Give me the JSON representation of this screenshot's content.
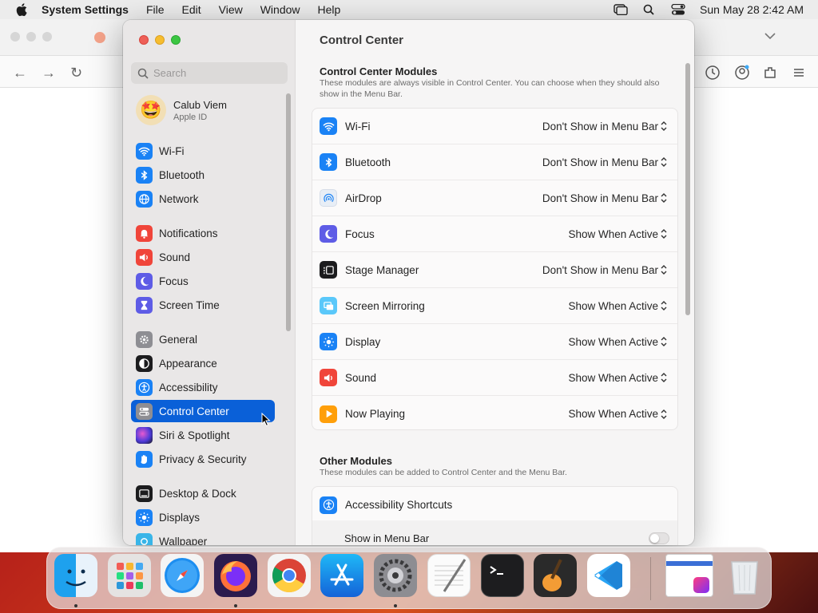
{
  "menubar": {
    "app_name": "System Settings",
    "menus": [
      "File",
      "Edit",
      "View",
      "Window",
      "Help"
    ],
    "datetime": "Sun May 28  2:42 AM"
  },
  "sidebar": {
    "search_placeholder": "Search",
    "profile": {
      "name": "Calub Viem",
      "subtitle": "Apple ID"
    },
    "items": [
      {
        "label": "Wi-Fi",
        "icon": "wifi-icon",
        "color": "#1a82f5"
      },
      {
        "label": "Bluetooth",
        "icon": "bluetooth-icon",
        "color": "#1a82f5"
      },
      {
        "label": "Network",
        "icon": "globe-icon",
        "color": "#1a82f5"
      },
      {
        "label": "Notifications",
        "icon": "bell-icon",
        "color": "#f0453a"
      },
      {
        "label": "Sound",
        "icon": "speaker-icon",
        "color": "#f0453a"
      },
      {
        "label": "Focus",
        "icon": "moon-icon",
        "color": "#5e5ce6"
      },
      {
        "label": "Screen Time",
        "icon": "hourglass-icon",
        "color": "#5e5ce6"
      },
      {
        "label": "General",
        "icon": "gear-icon",
        "color": "#8e8e93"
      },
      {
        "label": "Appearance",
        "icon": "appearance-icon",
        "color": "#1c1c1e"
      },
      {
        "label": "Accessibility",
        "icon": "accessibility-icon",
        "color": "#1a82f5"
      },
      {
        "label": "Control Center",
        "icon": "control-center-icon",
        "color": "#8e8e93"
      },
      {
        "label": "Siri & Spotlight",
        "icon": "siri-icon",
        "color": "#7b3fd6"
      },
      {
        "label": "Privacy & Security",
        "icon": "hand-icon",
        "color": "#1a82f5"
      },
      {
        "label": "Desktop & Dock",
        "icon": "dock-icon",
        "color": "#1c1c1e"
      },
      {
        "label": "Displays",
        "icon": "sun-icon",
        "color": "#1a82f5"
      },
      {
        "label": "Wallpaper",
        "icon": "wallpaper-icon",
        "color": "#39b5e8"
      }
    ]
  },
  "main": {
    "title": "Control Center",
    "modules_section": {
      "heading": "Control Center Modules",
      "description": "These modules are always visible in Control Center. You can choose when they should also show in the Menu Bar.",
      "rows": [
        {
          "label": "Wi-Fi",
          "value": "Don't Show in Menu Bar",
          "icon": "wifi-icon",
          "color": "#1a82f5"
        },
        {
          "label": "Bluetooth",
          "value": "Don't Show in Menu Bar",
          "icon": "bluetooth-icon",
          "color": "#1a82f5"
        },
        {
          "label": "AirDrop",
          "value": "Don't Show in Menu Bar",
          "icon": "airdrop-icon",
          "color": "#e8eef6"
        },
        {
          "label": "Focus",
          "value": "Show When Active",
          "icon": "moon-icon",
          "color": "#5e5ce6"
        },
        {
          "label": "Stage Manager",
          "value": "Don't Show in Menu Bar",
          "icon": "stage-manager-icon",
          "color": "#1c1c1e"
        },
        {
          "label": "Screen Mirroring",
          "value": "Show When Active",
          "icon": "screen-mirroring-icon",
          "color": "#5ac8fa"
        },
        {
          "label": "Display",
          "value": "Show When Active",
          "icon": "sun-icon",
          "color": "#1a82f5"
        },
        {
          "label": "Sound",
          "value": "Show When Active",
          "icon": "speaker-icon",
          "color": "#f0453a"
        },
        {
          "label": "Now Playing",
          "value": "Show When Active",
          "icon": "play-icon",
          "color": "#ff9f0a"
        }
      ]
    },
    "other_section": {
      "heading": "Other Modules",
      "description": "These modules can be added to Control Center and the Menu Bar.",
      "rows": [
        {
          "label": "Accessibility Shortcuts",
          "icon": "accessibility-icon",
          "color": "#1a82f5"
        },
        {
          "label": "Show in Menu Bar",
          "toggle": false
        }
      ]
    }
  },
  "dock": {
    "apps": [
      "Finder",
      "Launchpad",
      "Safari",
      "Firefox",
      "Chrome",
      "App Store",
      "System Settings",
      "TextEdit",
      "Terminal",
      "GarageBand",
      "Visual Studio Code",
      "Downloads",
      "Trash"
    ]
  }
}
